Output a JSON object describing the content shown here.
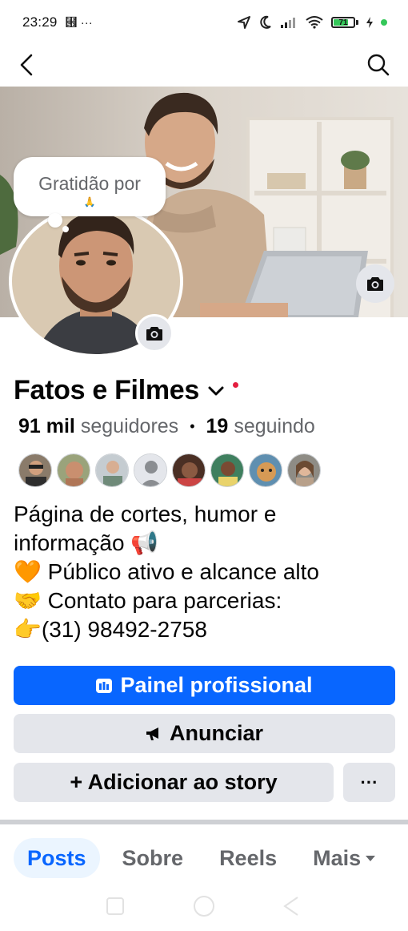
{
  "status_bar": {
    "time": "23:29",
    "extra_icons": "⹞ ···",
    "battery_level": "71",
    "battery_percent": 71,
    "battery_color": "#34c759"
  },
  "nav": {
    "back_icon": "chevron-left-icon",
    "search_icon": "search-icon"
  },
  "note": {
    "text": "Gratidão por",
    "emoji": "🙏"
  },
  "profile": {
    "name": "Fatos e Filmes",
    "followers_count": "91 mil",
    "followers_label": "seguidores",
    "separator": "•",
    "following_count": "19",
    "following_label": "seguindo",
    "bio": [
      "Página de cortes, humor e",
      "informação 📢",
      "🧡 Público ativo e alcance alto",
      "🤝 Contato para parcerias:",
      "👉(31) 98492-2758"
    ]
  },
  "buttons": {
    "dashboard": "Painel profissional",
    "advertise": "Anunciar",
    "add_story": "+ Adicionar ao story",
    "more": "···"
  },
  "tabs": {
    "posts": "Posts",
    "about": "Sobre",
    "reels": "Reels",
    "more": "Mais"
  },
  "colors": {
    "primary": "#0866ff",
    "secondary_bg": "#e4e6eb",
    "active_tab_bg": "#ebf5ff",
    "muted_text": "#65676b",
    "notification_dot": "#e41e3f"
  }
}
